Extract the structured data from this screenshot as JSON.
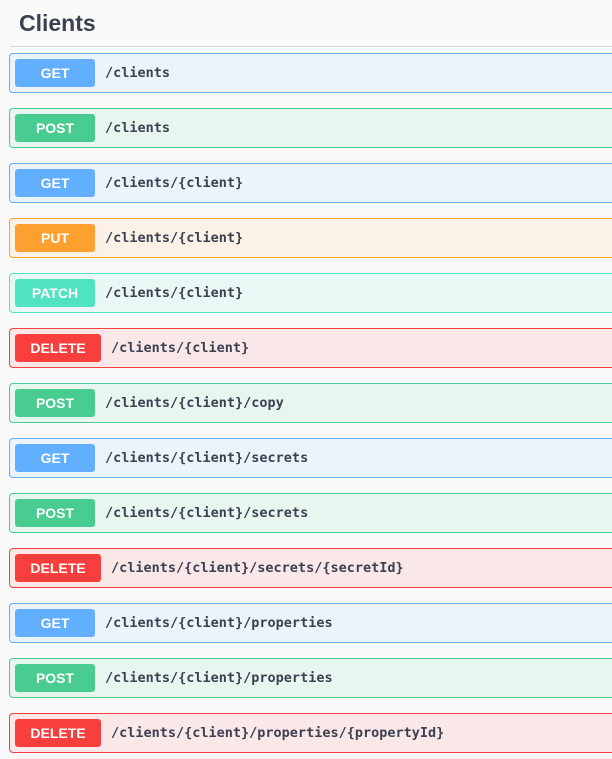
{
  "section": {
    "title": "Clients"
  },
  "colors": {
    "get": "#61affe",
    "post": "#49cc90",
    "put": "#fca130",
    "patch": "#50e3c2",
    "delete": "#f93e3e"
  },
  "operations": [
    {
      "method": "GET",
      "path": "/clients"
    },
    {
      "method": "POST",
      "path": "/clients"
    },
    {
      "method": "GET",
      "path": "/clients/{client}"
    },
    {
      "method": "PUT",
      "path": "/clients/{client}"
    },
    {
      "method": "PATCH",
      "path": "/clients/{client}"
    },
    {
      "method": "DELETE",
      "path": "/clients/{client}"
    },
    {
      "method": "POST",
      "path": "/clients/{client}/copy"
    },
    {
      "method": "GET",
      "path": "/clients/{client}/secrets"
    },
    {
      "method": "POST",
      "path": "/clients/{client}/secrets"
    },
    {
      "method": "DELETE",
      "path": "/clients/{client}/secrets/{secretId}"
    },
    {
      "method": "GET",
      "path": "/clients/{client}/properties"
    },
    {
      "method": "POST",
      "path": "/clients/{client}/properties"
    },
    {
      "method": "DELETE",
      "path": "/clients/{client}/properties/{propertyId}"
    }
  ]
}
